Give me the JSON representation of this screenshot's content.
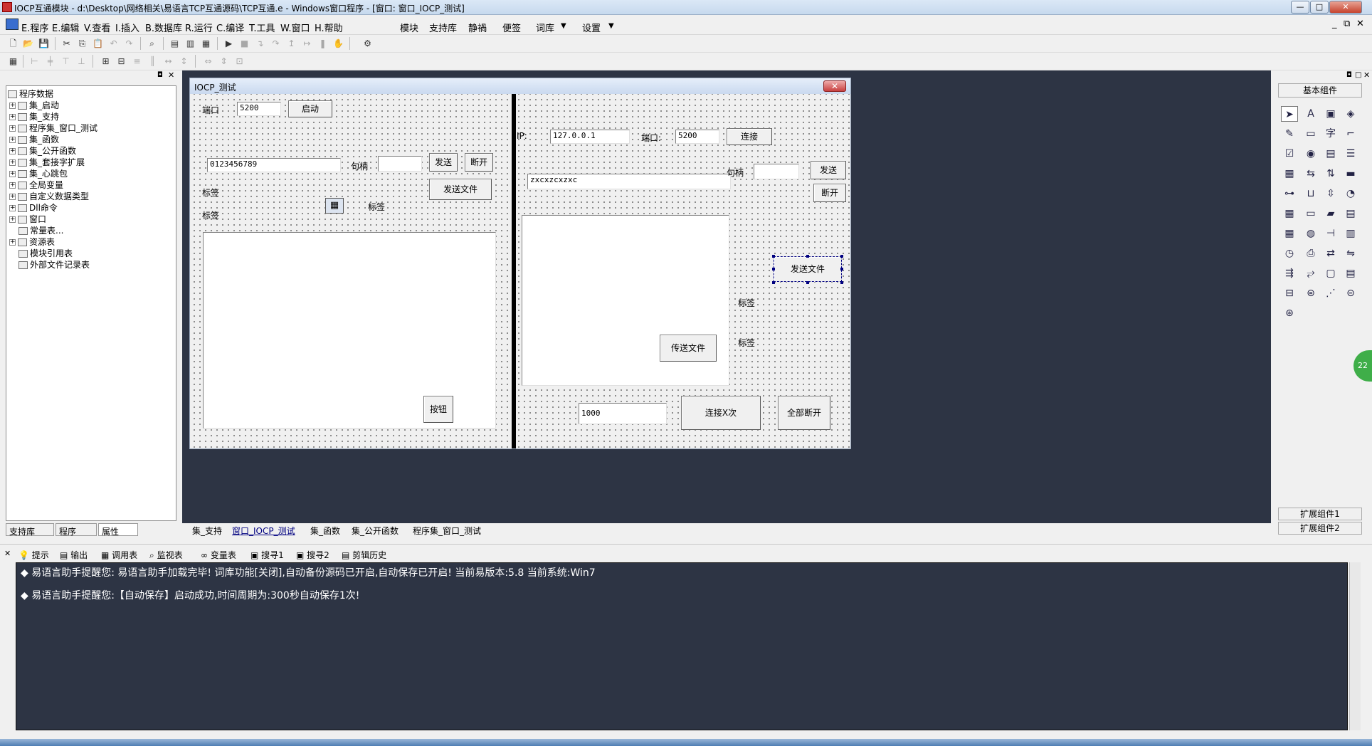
{
  "titlebar": {
    "title": "IOCP互通模块 - d:\\Desktop\\网络相关\\易语言TCP互通源码\\TCP互通.e - Windows窗口程序 - [窗口: 窗口_IOCP_测试]"
  },
  "menu": [
    "E.程序",
    "E.编辑",
    "V.查看",
    "I.插入",
    "B.数据库",
    "R.运行",
    "C.编译",
    "T.工具",
    "W.窗口",
    "H.帮助"
  ],
  "menu_right": [
    "模块",
    "支持库",
    "静禍",
    "便签",
    "词库",
    "设置"
  ],
  "tree": {
    "root": "程序数据",
    "items": [
      "集_启动",
      "集_支持",
      "程序集_窗口_测试",
      "集_函数",
      "集_公开函数",
      "集_套接字扩展",
      "集_心跳包",
      "全局变量",
      "自定义数据类型",
      "Dll命令",
      "窗口",
      "常量表...",
      "资源表",
      "模块引用表",
      "外部文件记录表"
    ]
  },
  "left_tabs": [
    "支持库",
    "程序",
    "属性"
  ],
  "form": {
    "title": "IOCP_测试",
    "left": {
      "port_label": "端口",
      "port_value": "5200",
      "start_btn": "启动",
      "data_value": "0123456789",
      "handle_label": "句柄",
      "send_btn": "发送",
      "disconnect_btn": "断开",
      "sendfile_btn": "发送文件",
      "label1": "标签",
      "label2": "标签",
      "label3": "标签",
      "button_btn": "按钮"
    },
    "right": {
      "ip_label": "IP:",
      "ip_value": "127.0.0.1",
      "port_label": "端口:",
      "port_value": "5200",
      "connect_btn": "连接",
      "data_value": "zxcxzcxzxc",
      "handle_label": "句柄",
      "send_btn": "发送",
      "disconnect_btn": "断开",
      "sendfile_btn": "发送文件",
      "label1": "标签",
      "label2": "标签",
      "transfer_btn": "传送文件",
      "count_value": "1000",
      "connectx_btn": "连接X次",
      "disconnect_all_btn": "全部断开"
    }
  },
  "palette": {
    "title": "基本组件",
    "ext1": "扩展组件1",
    "ext2": "扩展组件2"
  },
  "code_tabs": [
    "集_支持",
    "窗口_IOCP_测试",
    "集_函数",
    "集_公开函数",
    "程序集_窗口_测试"
  ],
  "output_tabs": [
    "提示",
    "输出",
    "调用表",
    "监视表",
    "变量表",
    "搜寻1",
    "搜寻2",
    "剪辑历史"
  ],
  "output_lines": [
    "易语言助手提醒您:  易语言助手加载完毕! 词库功能[关闭],自动备份源码已开启,自动保存已开启! 当前易版本:5.8  当前系统:Win7",
    "易语言助手提醒您:【自动保存】启动成功,时间周期为:300秒自动保存1次!"
  ],
  "colors": {
    "design_bg": "#2d3444",
    "output_bg": "#2d3444"
  }
}
